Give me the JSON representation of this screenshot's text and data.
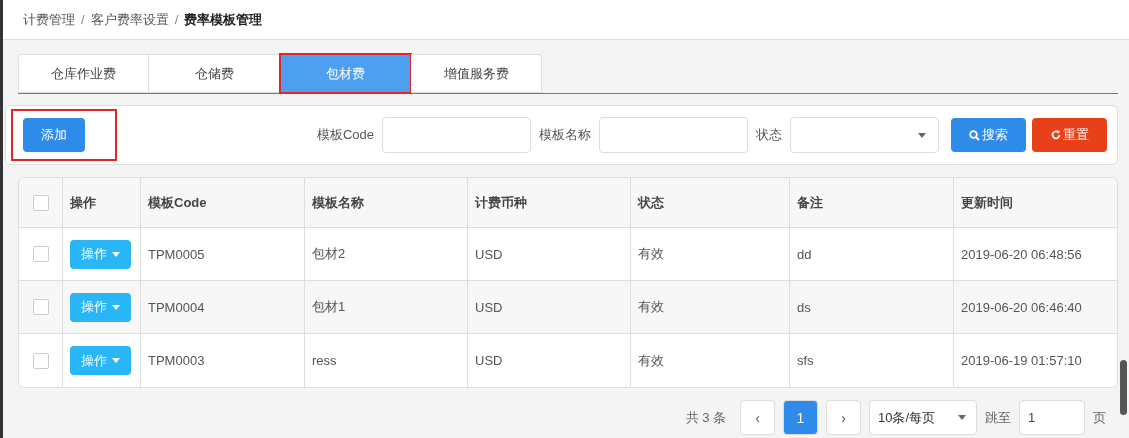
{
  "breadcrumb": [
    "计费管理",
    "客户费率设置",
    "费率模板管理"
  ],
  "breadcrumb_separator": "/",
  "tabs": [
    {
      "label": "仓库作业费",
      "selected": false,
      "highlighted": false
    },
    {
      "label": "仓储费",
      "selected": false,
      "highlighted": false
    },
    {
      "label": "包材费",
      "selected": true,
      "highlighted": true
    },
    {
      "label": "增值服务费",
      "selected": false,
      "highlighted": false
    }
  ],
  "add_button": {
    "label": "添加",
    "highlighted": true
  },
  "filters": [
    {
      "label": "模板Code",
      "kind": "text"
    },
    {
      "label": "模板名称",
      "kind": "text"
    },
    {
      "label": "状态",
      "kind": "select"
    }
  ],
  "search_button": "搜索",
  "reset_button": "重置",
  "table": {
    "columns": [
      {
        "kind": "checkbox",
        "checked": false
      },
      {
        "kind": "text",
        "text": "操作"
      },
      {
        "kind": "text",
        "text": "模板Code"
      },
      {
        "kind": "text",
        "text": "模板名称"
      },
      {
        "kind": "text",
        "text": "计费币种"
      },
      {
        "kind": "text",
        "text": "状态"
      },
      {
        "kind": "text",
        "text": "备注"
      },
      {
        "kind": "text",
        "text": "更新时间"
      }
    ],
    "rows": [
      {
        "cells": [
          {
            "kind": "checkbox",
            "checked": false
          },
          {
            "kind": "button",
            "text": "操作"
          },
          {
            "kind": "text",
            "text": "TPM0005"
          },
          {
            "kind": "text",
            "text": "包材2"
          },
          {
            "kind": "text",
            "text": "USD"
          },
          {
            "kind": "text",
            "text": "有效"
          },
          {
            "kind": "text",
            "text": "dd"
          },
          {
            "kind": "text",
            "text": "2019-06-20 06:48:56"
          }
        ]
      },
      {
        "cells": [
          {
            "kind": "checkbox",
            "checked": false
          },
          {
            "kind": "button",
            "text": "操作"
          },
          {
            "kind": "text",
            "text": "TPM0004"
          },
          {
            "kind": "text",
            "text": "包材1"
          },
          {
            "kind": "text",
            "text": "USD"
          },
          {
            "kind": "text",
            "text": "有效"
          },
          {
            "kind": "text",
            "text": "ds"
          },
          {
            "kind": "text",
            "text": "2019-06-20 06:46:40"
          }
        ]
      },
      {
        "cells": [
          {
            "kind": "checkbox",
            "checked": false
          },
          {
            "kind": "button",
            "text": "操作"
          },
          {
            "kind": "text",
            "text": "TPM0003"
          },
          {
            "kind": "text",
            "text": "ress"
          },
          {
            "kind": "text",
            "text": "USD"
          },
          {
            "kind": "text",
            "text": "有效"
          },
          {
            "kind": "text",
            "text": "sfs"
          },
          {
            "kind": "text",
            "text": "2019-06-19 01:57:10"
          }
        ]
      }
    ]
  },
  "pagination": {
    "total": "共 3 条",
    "prev": "‹",
    "pages": [
      {
        "label": "1",
        "selected": true
      }
    ],
    "next": "›",
    "page_size": "10条/每页",
    "jump_label": "跳至",
    "jump_value": "1",
    "page_unit": "页"
  }
}
